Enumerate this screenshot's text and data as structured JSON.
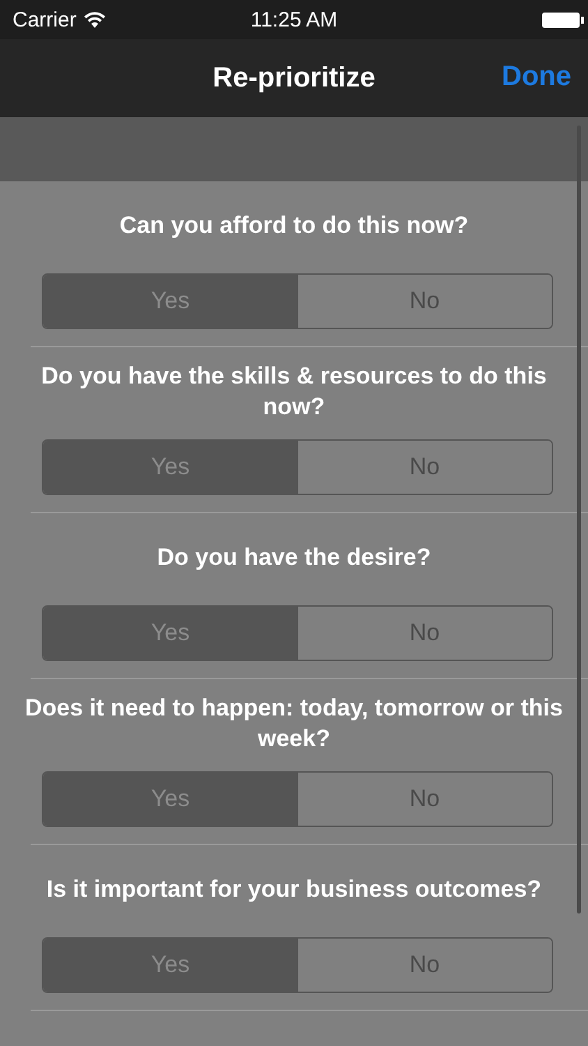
{
  "status_bar": {
    "carrier": "Carrier",
    "time": "11:25 AM"
  },
  "nav_bar": {
    "title": "Re-prioritize",
    "done": "Done"
  },
  "questions": [
    {
      "text": "Can you afford to do this now?",
      "options": [
        {
          "label": "Yes",
          "selected": true
        },
        {
          "label": "No",
          "selected": false
        }
      ]
    },
    {
      "text": "Do you have the skills & resources to do this now?",
      "options": [
        {
          "label": "Yes",
          "selected": true
        },
        {
          "label": "No",
          "selected": false
        }
      ]
    },
    {
      "text": "Do you have the desire?",
      "options": [
        {
          "label": "Yes",
          "selected": true
        },
        {
          "label": "No",
          "selected": false
        }
      ]
    },
    {
      "text": "Does it need to happen: today, tomorrow or this week?",
      "options": [
        {
          "label": "Yes",
          "selected": true
        },
        {
          "label": "No",
          "selected": false
        }
      ]
    },
    {
      "text": "Is it important for your business outcomes?",
      "options": [
        {
          "label": "Yes",
          "selected": true
        },
        {
          "label": "No",
          "selected": false
        }
      ]
    }
  ]
}
